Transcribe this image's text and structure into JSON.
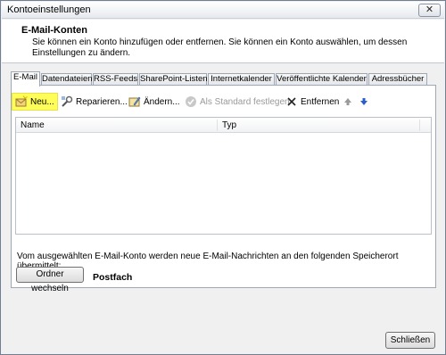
{
  "window": {
    "title": "Kontoeinstellungen",
    "close_glyph": "✕"
  },
  "header": {
    "title": "E-Mail-Konten",
    "description": "Sie können ein Konto hinzufügen oder entfernen. Sie können ein Konto auswählen, um dessen Einstellungen zu ändern."
  },
  "tabs": [
    {
      "label": "E-Mail"
    },
    {
      "label": "Datendateien"
    },
    {
      "label": "RSS-Feeds"
    },
    {
      "label": "SharePoint-Listen"
    },
    {
      "label": "Internetkalender"
    },
    {
      "label": "Veröffentlichte Kalender"
    },
    {
      "label": "Adressbücher"
    }
  ],
  "toolbar": {
    "new": "Neu...",
    "repair": "Reparieren...",
    "change": "Ändern...",
    "set_default": "Als Standard festlegen",
    "remove": "Entfernen"
  },
  "list": {
    "columns": [
      "Name",
      "Typ"
    ]
  },
  "store": {
    "text": "Vom ausgewählten E-Mail-Konto werden neue E-Mail-Nachrichten an den folgenden Speicherort übermittelt:",
    "change_folder": "Ordner wechseln",
    "folder": "Postfach"
  },
  "footer": {
    "close": "Schließen"
  },
  "colors": {
    "highlight": "#fffe59",
    "accent_blue": "#2a5fc8"
  }
}
